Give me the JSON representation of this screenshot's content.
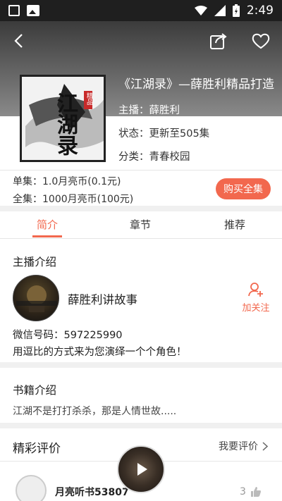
{
  "status_bar": {
    "time": "2:49"
  },
  "book": {
    "title": "《江湖录》—薛胜利精品打造",
    "host": "主播：薛胜利",
    "status": "状态：更新至505集",
    "category": "分类：青春校园",
    "cover_text": "江湖录",
    "cover_badge": "精品"
  },
  "pricing": {
    "single": "单集：1.0月亮币(0.1元)",
    "full": "全集：1000月亮币(100元)",
    "buy_label": "购买全集"
  },
  "tabs": [
    {
      "label": "简介",
      "active": true
    },
    {
      "label": "章节",
      "active": false
    },
    {
      "label": "推荐",
      "active": false
    }
  ],
  "host_section": {
    "title": "主播介绍",
    "name": "薛胜利讲故事",
    "follow_label": "加关注",
    "wechat": "微信号码：597225990",
    "motto": "用逗比的方式来为您演绎一个个角色！"
  },
  "book_section": {
    "title": "书籍介绍",
    "desc": "江湖不是打打杀杀，那是人情世故....."
  },
  "review_section": {
    "title": "精彩评价",
    "write_label": "我要评价",
    "reviewer": "月亮听书53807",
    "likes": "3"
  },
  "colors": {
    "accent": "#f2684e"
  }
}
